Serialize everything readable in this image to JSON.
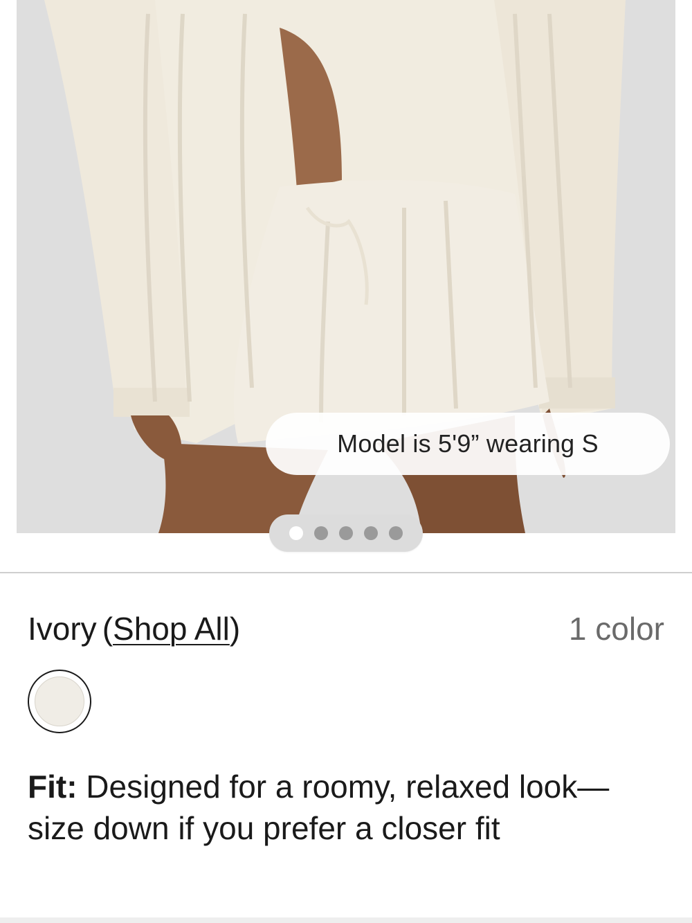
{
  "product_image": {
    "model_info": "Model is 5'9” wearing S",
    "carousel": {
      "total": 5,
      "active": 1
    }
  },
  "color_section": {
    "selected_color": "Ivory",
    "open_paren": "(",
    "shop_all_label": "Shop All",
    "close_paren": ")",
    "color_count": "1 color",
    "swatch_color": "#f0ede6"
  },
  "fit": {
    "label": "Fit:",
    "text": "Designed for a roomy, relaxed look—size down if you prefer a closer fit"
  }
}
